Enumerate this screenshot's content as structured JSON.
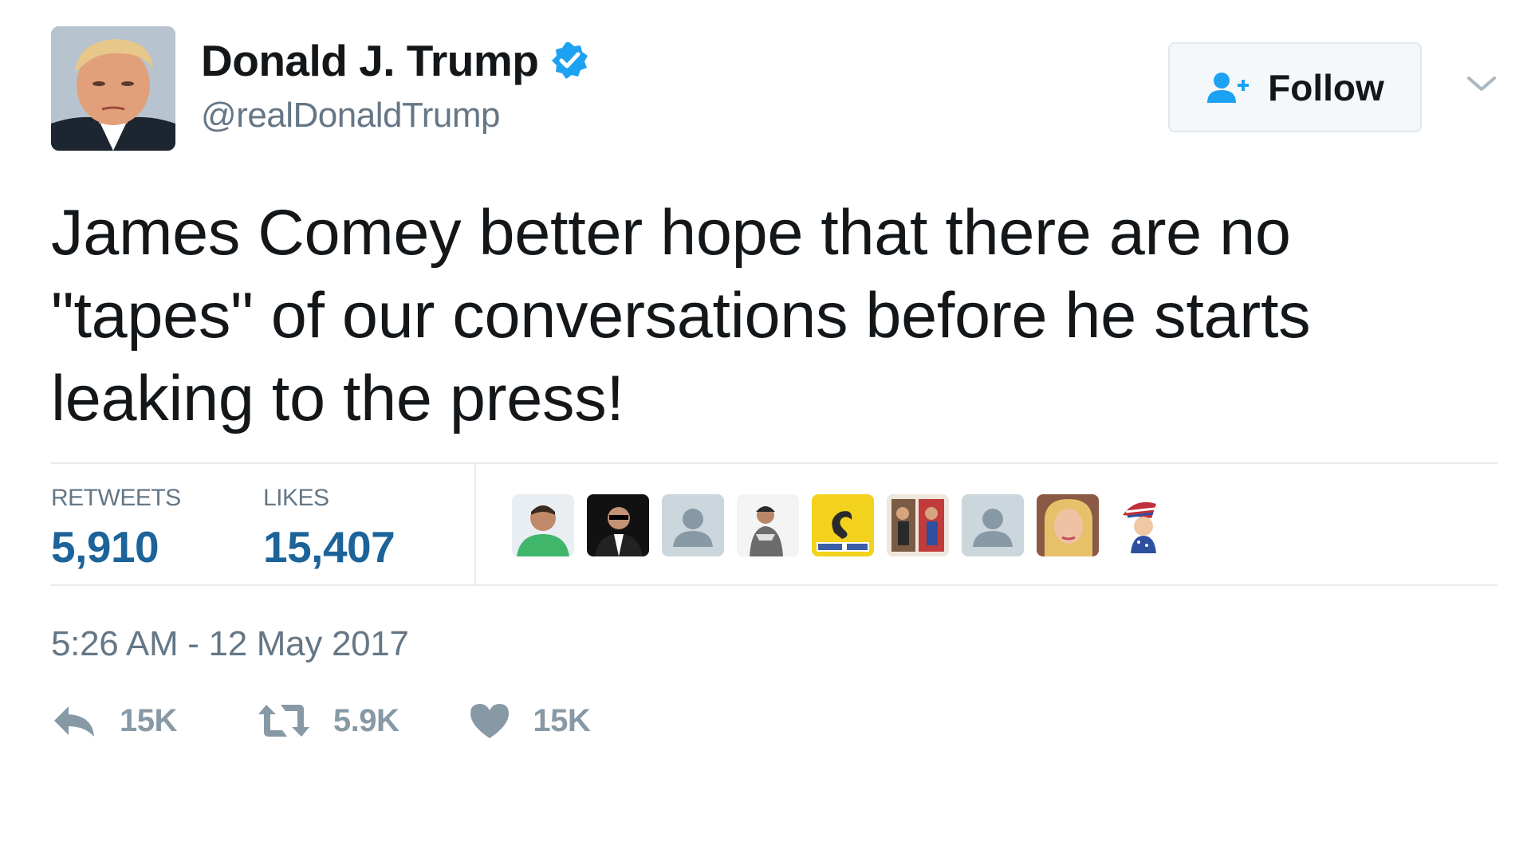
{
  "user": {
    "display_name": "Donald J. Trump",
    "handle": "@realDonaldTrump",
    "verified": true,
    "avatar_icon": "profile-photo",
    "verified_color": "#1da1f2"
  },
  "follow_button": {
    "label": "Follow",
    "icon": "add-user-icon",
    "icon_color": "#1da1f2"
  },
  "tweet": {
    "text": "James Comey better hope that there are no \"tapes\" of our conversations before he starts leaking to the press!",
    "timestamp": "5:26 AM - 12 May 2017"
  },
  "stats": {
    "retweets_label": "RETWEETS",
    "retweets_value": "5,910",
    "likes_label": "LIKES",
    "likes_value": "15,407",
    "value_color": "#1c6399"
  },
  "likers": [
    {
      "icon": "liker-avatar-1",
      "color": "#5fae73"
    },
    {
      "icon": "liker-avatar-2",
      "color": "#1a1a1a"
    },
    {
      "icon": "default-avatar-icon",
      "color": "#a9b4bf"
    },
    {
      "icon": "liker-avatar-4",
      "color": "#9a9a9a"
    },
    {
      "icon": "liker-avatar-5",
      "color": "#f2d21c"
    },
    {
      "icon": "liker-avatar-6",
      "color": "#8b6d56"
    },
    {
      "icon": "default-avatar-icon",
      "color": "#a9b4bf"
    },
    {
      "icon": "liker-avatar-8",
      "color": "#c98f70"
    },
    {
      "icon": "liker-avatar-9",
      "color": "#ffffff"
    }
  ],
  "actions": {
    "reply_count": "15K",
    "retweet_count": "5.9K",
    "like_count": "15K",
    "icon_color": "#8899a6"
  }
}
